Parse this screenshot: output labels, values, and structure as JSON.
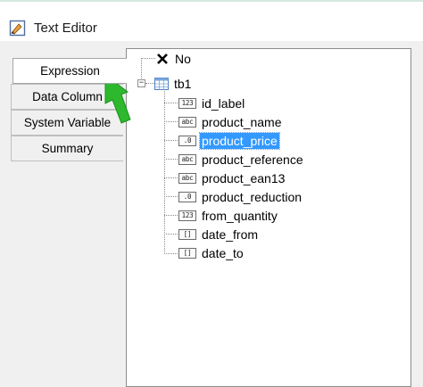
{
  "window": {
    "title": "Text Editor",
    "icon": "text-editor-icon"
  },
  "tabs": [
    {
      "label": "Expression",
      "active": true
    },
    {
      "label": "Data Column",
      "active": false
    },
    {
      "label": "System Variable",
      "active": false
    },
    {
      "label": "Summary",
      "active": false
    }
  ],
  "tree": {
    "root_no": {
      "label": "No",
      "icon": "x-icon"
    },
    "table": {
      "label": "tb1",
      "icon": "table-icon",
      "expander": "−"
    },
    "fields": [
      {
        "label": "id_label",
        "type_badge": "123",
        "icon": "number-field-icon",
        "selected": false
      },
      {
        "label": "product_name",
        "type_badge": "abc",
        "icon": "text-field-icon",
        "selected": false
      },
      {
        "label": "product_price",
        "type_badge": ".0",
        "icon": "decimal-field-icon",
        "selected": true
      },
      {
        "label": "product_reference",
        "type_badge": "abc",
        "icon": "text-field-icon",
        "selected": false
      },
      {
        "label": "product_ean13",
        "type_badge": "abc",
        "icon": "text-field-icon",
        "selected": false
      },
      {
        "label": "product_reduction",
        "type_badge": ".0",
        "icon": "decimal-field-icon",
        "selected": false
      },
      {
        "label": "from_quantity",
        "type_badge": "123",
        "icon": "number-field-icon",
        "selected": false
      },
      {
        "label": "date_from",
        "type_badge": "[]",
        "icon": "date-field-icon",
        "selected": false
      },
      {
        "label": "date_to",
        "type_badge": "[]",
        "icon": "date-field-icon",
        "selected": false
      }
    ]
  },
  "annotation": {
    "color": "#2eb82e",
    "icon": "green-arrow"
  }
}
